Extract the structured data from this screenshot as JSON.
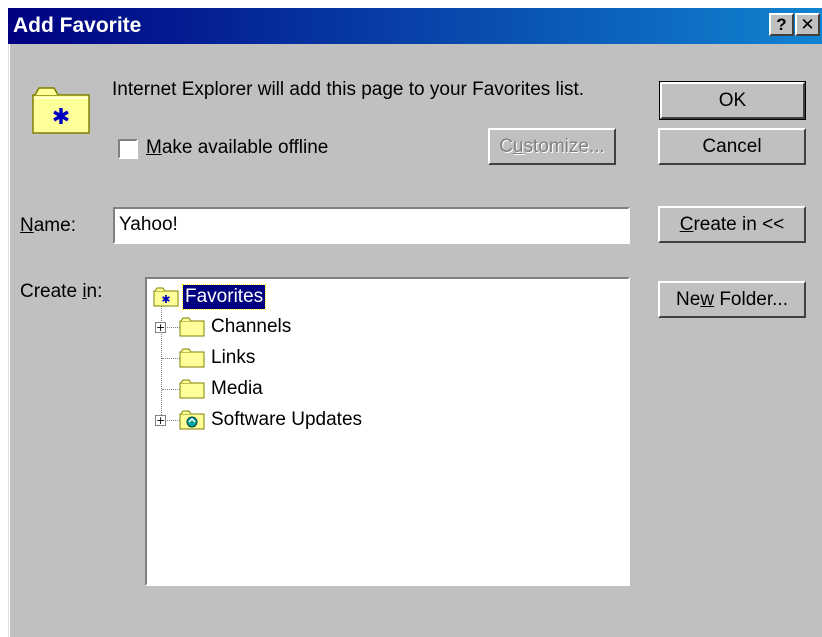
{
  "window": {
    "title": "Add Favorite",
    "help_label": "?",
    "close_label": "✕"
  },
  "info": {
    "message": "Internet Explorer will add this page to your Favorites list."
  },
  "offline": {
    "checked": false,
    "label_mnemonic": "M",
    "label_rest": "ake available offline"
  },
  "buttons": {
    "ok": "OK",
    "cancel": "Cancel",
    "customize_pre": "C",
    "customize_mnemonic": "u",
    "customize_rest": "stomize...",
    "create_in_mnemonic": "C",
    "create_in_rest": "reate in <<",
    "new_folder_pre": "Ne",
    "new_folder_mnemonic": "w",
    "new_folder_rest": " Folder..."
  },
  "name_field": {
    "label_mnemonic": "N",
    "label_rest": "ame:",
    "value": "Yahoo!"
  },
  "create_in": {
    "label_pre": "Create ",
    "label_mnemonic": "i",
    "label_rest": "n:"
  },
  "tree": {
    "root": {
      "label": "Favorites",
      "selected": true,
      "icon": "favorites-folder-icon"
    },
    "items": [
      {
        "label": "Channels",
        "expandable": true,
        "icon": "folder-icon"
      },
      {
        "label": "Links",
        "expandable": false,
        "icon": "folder-icon"
      },
      {
        "label": "Media",
        "expandable": false,
        "icon": "folder-icon"
      },
      {
        "label": "Software Updates",
        "expandable": true,
        "icon": "software-updates-folder-icon"
      }
    ],
    "expander_glyph": "+"
  },
  "colors": {
    "titlebar_start": "#000080",
    "titlebar_end": "#1084d0",
    "dialog_face": "#c0c0c0",
    "selection": "#000080",
    "folder_yellow": "#ffff99"
  }
}
